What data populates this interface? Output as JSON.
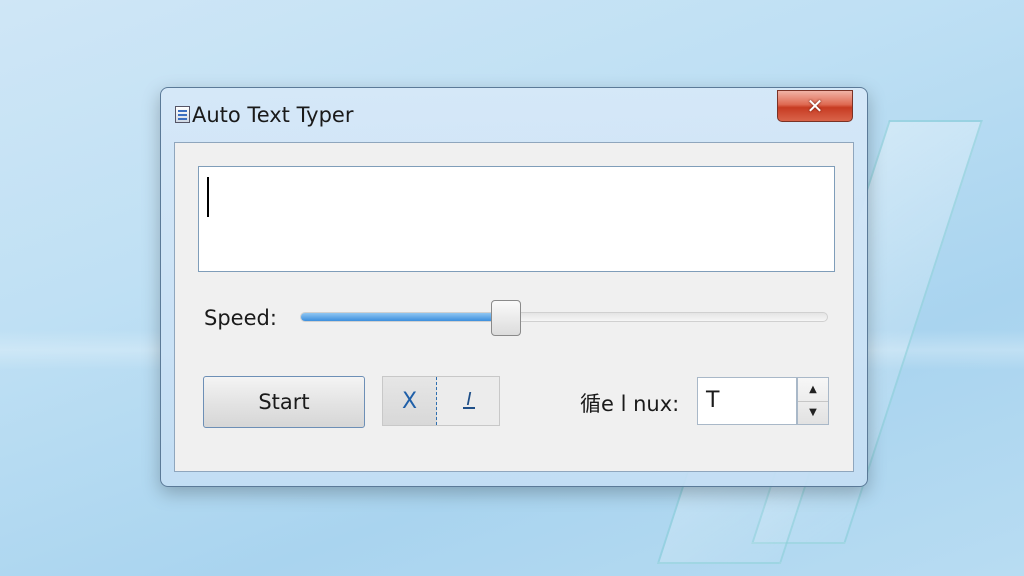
{
  "window": {
    "title": "Auto Text Typer",
    "close_label": "✕"
  },
  "textbox": {
    "value": ""
  },
  "speed": {
    "label": "Speed:",
    "fraction": 0.39
  },
  "start_button": {
    "label": "Start"
  },
  "toggles": {
    "a_glyph": "X",
    "b_glyph": "I"
  },
  "spin_field": {
    "label": "循e l nux:",
    "value": "T",
    "up_glyph": "▲",
    "down_glyph": "▼"
  },
  "colors": {
    "accent": "#3d8fdd",
    "close": "#c73b22"
  }
}
